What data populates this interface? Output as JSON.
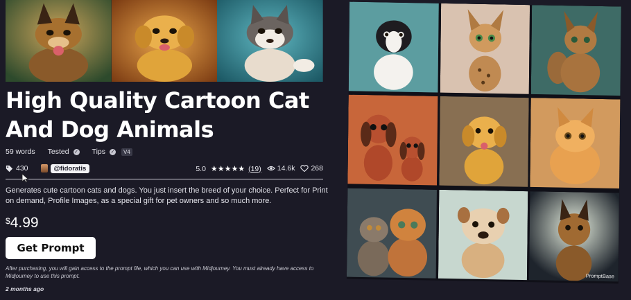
{
  "product": {
    "title": "High Quality Cartoon Cat And Dog Animals",
    "word_count": "59 words",
    "tested_label": "Tested",
    "tips_label": "Tips",
    "version": "V4",
    "tag_count": "430",
    "author": "@fidoratis",
    "rating": "5.0",
    "stars": "★★★★★",
    "reviews": "(19)",
    "views": "14.6k",
    "likes": "268",
    "description": "Generates cute cartoon cats and dogs. You just insert the breed of your choice. Perfect for Print on demand, Profile Images, as a special gift for pet owners and so much more.",
    "currency": "$",
    "price": "4.99",
    "buy_label": "Get Prompt",
    "purchase_note": "After purchasing, you will gain access to the prompt file, which you can use with Midjourney. You must already have access to Midjourney to use this prompt.",
    "posted": "2 months ago"
  },
  "hero_images": [
    {
      "subject": "german-shepherd",
      "bg": "#3f6a3c"
    },
    {
      "subject": "golden-retriever",
      "bg": "#c06a22"
    },
    {
      "subject": "husky-puppy",
      "bg": "#2e8a96"
    }
  ],
  "gallery": {
    "watermark": "PromptBase",
    "images": [
      {
        "subject": "border-collie",
        "bg": "#4b8a90"
      },
      {
        "subject": "bengal-kitten",
        "bg": "#d9c2b0"
      },
      {
        "subject": "maine-coon",
        "bg": "#3e6b66"
      },
      {
        "subject": "dachshunds",
        "bg": "#c8663a"
      },
      {
        "subject": "golden-puppy",
        "bg": "#6b5a48"
      },
      {
        "subject": "orange-cat",
        "bg": "#d29a5e"
      },
      {
        "subject": "fluffy-cats",
        "bg": "#3f4c52"
      },
      {
        "subject": "bulldog",
        "bg": "#c7d7cf"
      },
      {
        "subject": "shepherd-puppy",
        "bg": "#2a3038"
      }
    ]
  }
}
